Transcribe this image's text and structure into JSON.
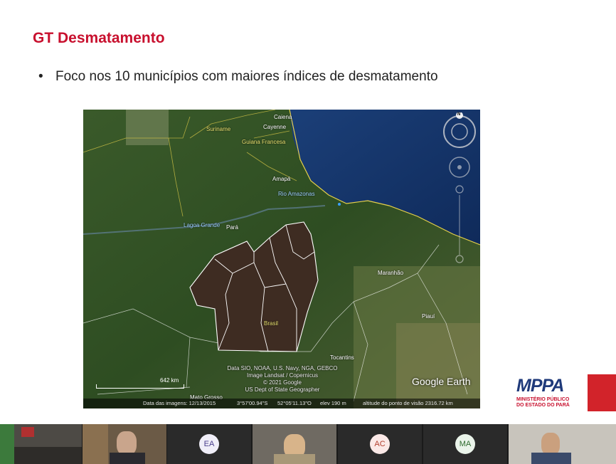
{
  "slide": {
    "title": "GT Desmatamento",
    "bullet_symbol": "•",
    "bullet_text": "Foco nos 10 municípios com maiores índices de desmatamento"
  },
  "map": {
    "labels": {
      "caiena": "Caiena",
      "cayenne": "Cayenne",
      "suriname": "Suriname",
      "guiana_francesa": "Guiana Francesa",
      "amapa": "Amapá",
      "rio_amazonas": "Rio Amazonas",
      "lagoa_grande": "Lagoa Grande",
      "para": "Pará",
      "maranhao": "Maranhão",
      "piaui": "Piauí",
      "brasil": "Brasil",
      "tocantins": "Tocantins",
      "mato_grosso": "Mato Grosso"
    },
    "credits": [
      "Data SIO, NOAA, U.S. Navy, NGA, GEBCO",
      "Image Landsat / Copernicus",
      "© 2021 Google",
      "US Dept of State Geographer"
    ],
    "scale_label": "642 km",
    "brand": "Google Earth",
    "compass": "N",
    "status": {
      "imagery_date": "Data das imagens: 12/13/2015",
      "latitude": "3°57'00.94\"S",
      "longitude": "52°05'11.13\"O",
      "elevation": "elev   190 m",
      "eye_altitude": "altitude do ponto de visão 2316.72 km"
    }
  },
  "logo": {
    "name": "MPPA",
    "line1": "MINISTÉRIO PÚBLICO",
    "line2": "DO ESTADO DO PARÁ"
  },
  "participants": [
    {
      "type": "video",
      "initials": ""
    },
    {
      "type": "video",
      "initials": ""
    },
    {
      "type": "avatar",
      "initials": "EA",
      "bg": "#f0eef8",
      "fg": "#4a3e8c"
    },
    {
      "type": "video",
      "initials": ""
    },
    {
      "type": "avatar",
      "initials": "AC",
      "bg": "#fbe9e7",
      "fg": "#b3402f"
    },
    {
      "type": "avatar",
      "initials": "MA",
      "bg": "#eaf4ea",
      "fg": "#2e6b2e"
    },
    {
      "type": "video",
      "initials": ""
    }
  ]
}
